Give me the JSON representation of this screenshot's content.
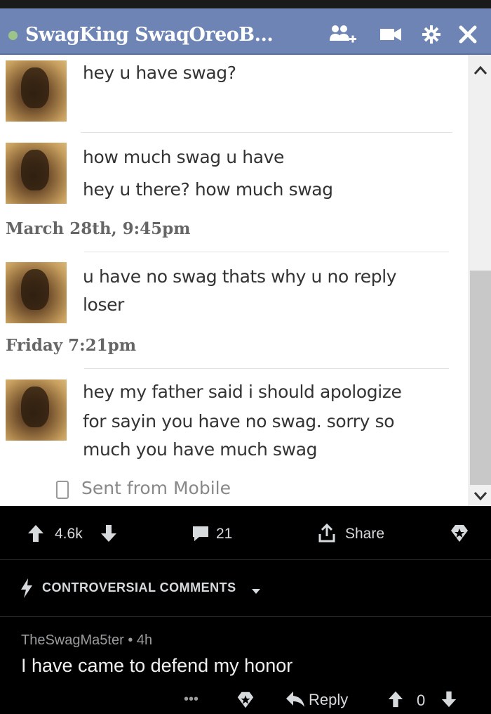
{
  "chat": {
    "title": "SwagKing SwaqOreoB...",
    "messages_1": [
      "hey u have swag?"
    ],
    "messages_2": [
      "how much swag u have",
      "hey u there? how much swag"
    ],
    "timestamp_1": "March 28th, 9:45pm",
    "messages_3": [
      "u have no swag thats why u no reply",
      "loser"
    ],
    "timestamp_2": "Friday 7:21pm",
    "messages_4": [
      "hey my father said i should apologize",
      "for sayin you have no swag. sorry so",
      "much you have much swag"
    ],
    "sent_from": "Sent from Mobile"
  },
  "post_actions": {
    "score": "4.6k",
    "comments_count": "21",
    "share_label": "Share"
  },
  "sort": {
    "label": "CONTROVERSIAL COMMENTS"
  },
  "comment": {
    "author": "TheSwagMa5ter",
    "age": "4h",
    "body": "I have came to defend my honor",
    "more": "•••",
    "reply_label": "Reply",
    "score": "0"
  },
  "colors": {
    "chat_header": "#6d84b4",
    "dark_bg": "#000000",
    "text_light": "#d7dadc"
  }
}
